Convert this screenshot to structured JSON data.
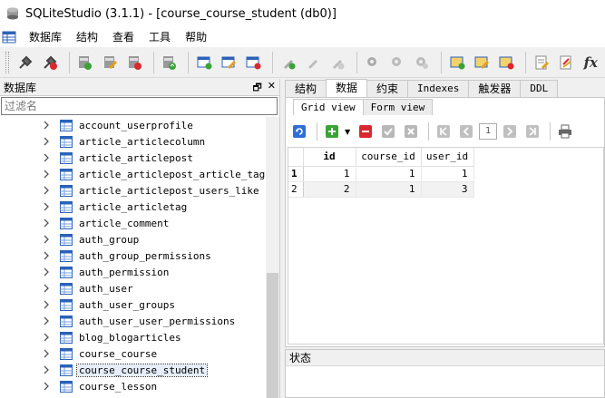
{
  "window": {
    "title": "SQLiteStudio (3.1.1) - [course_course_student (db0)]"
  },
  "menubar": {
    "items": [
      "数据库",
      "结构",
      "查看",
      "工具",
      "帮助"
    ]
  },
  "toolbar": {
    "fx_label": "fx"
  },
  "left_panel": {
    "title": "数据库",
    "filter_placeholder": "过滤名",
    "tables": [
      "account_userprofile",
      "article_articlecolumn",
      "article_articlepost",
      "article_articlepost_article_tag",
      "article_articlepost_users_like",
      "article_articletag",
      "article_comment",
      "auth_group",
      "auth_group_permissions",
      "auth_permission",
      "auth_user",
      "auth_user_groups",
      "auth_user_user_permissions",
      "blog_blogarticles",
      "course_course",
      "course_course_student",
      "course_lesson"
    ],
    "selected_table": "course_course_student"
  },
  "tabs": [
    "结构",
    "数据",
    "约束",
    "Indexes",
    "触发器",
    "DDL"
  ],
  "active_tab": "数据",
  "subtabs": [
    "Grid view",
    "Form view"
  ],
  "active_subtab": "Grid view",
  "grid_tools": {
    "page": "1"
  },
  "grid": {
    "columns": [
      "id",
      "course_id",
      "user_id"
    ],
    "rows": [
      {
        "num": "1",
        "cells": [
          "1",
          "1",
          "1"
        ]
      },
      {
        "num": "2",
        "cells": [
          "2",
          "1",
          "3"
        ]
      }
    ]
  },
  "status_panel": {
    "title": "状态"
  },
  "colors": {
    "selection": "#e5eefa",
    "green": "#3aa335",
    "red": "#d9282f",
    "blue": "#2f6fd6"
  }
}
